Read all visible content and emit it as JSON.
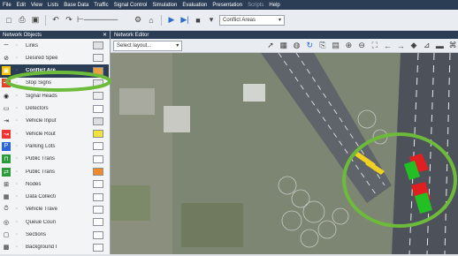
{
  "menu": [
    "File",
    "Edit",
    "View",
    "Lists",
    "Base Data",
    "Traffic",
    "Signal Control",
    "Simulation",
    "Evaluation",
    "Presentation",
    "Scripts",
    "Help"
  ],
  "toolbar": {
    "conflict_combo": "Conflict Areas"
  },
  "network_objects": {
    "title": "Network Objects",
    "items": [
      {
        "label": "Links",
        "icon": "links-icon",
        "swatch": "#e0e0e0"
      },
      {
        "label": "Desired Spee",
        "icon": "desired-speed-icon",
        "swatch": "#f0f0f0"
      },
      {
        "label": "Conflict Are",
        "icon": "conflict-area-icon",
        "swatch": "#e8a040",
        "selected": true
      },
      {
        "label": "Stop Signs",
        "icon": "stop-sign-icon",
        "swatch": "#e8e8e8"
      },
      {
        "label": "Signal Heads",
        "icon": "signal-head-icon",
        "swatch": "#eeeeee"
      },
      {
        "label": "Detectors",
        "icon": "detector-icon",
        "swatch": "#ffffff"
      },
      {
        "label": "Vehicle Input",
        "icon": "vehicle-input-icon",
        "swatch": "#dddddd"
      },
      {
        "label": "Vehicle Rout",
        "icon": "vehicle-route-icon",
        "swatch": "#f2e23a"
      },
      {
        "label": "Parking Lots",
        "icon": "parking-icon",
        "swatch": "#ffffff"
      },
      {
        "label": "Public Trans",
        "icon": "public-transport-stop-icon",
        "swatch": "#ffffff"
      },
      {
        "label": "Public Trans",
        "icon": "public-transport-line-icon",
        "swatch": "#f08a2a"
      },
      {
        "label": "Nodes",
        "icon": "node-icon",
        "swatch": "#ffffff"
      },
      {
        "label": "Data Collecti",
        "icon": "data-collection-icon",
        "swatch": "#ffffff"
      },
      {
        "label": "Vehicle Trave",
        "icon": "travel-time-icon",
        "swatch": "#ffffff"
      },
      {
        "label": "Queue Coun",
        "icon": "queue-counter-icon",
        "swatch": "#ffffff"
      },
      {
        "label": "Sections",
        "icon": "section-icon",
        "swatch": "#ffffff"
      },
      {
        "label": "Background I",
        "icon": "background-image-icon",
        "swatch": "#ffffff"
      }
    ]
  },
  "editor": {
    "title": "Network Editor",
    "layout_placeholder": "Select layout..."
  },
  "colors": {
    "highlight_ring": "#6dbb3a",
    "title_bar": "#2b3d55",
    "conflict_green": "#22c022",
    "conflict_red": "#e02020",
    "route_yellow": "#f0d020"
  }
}
